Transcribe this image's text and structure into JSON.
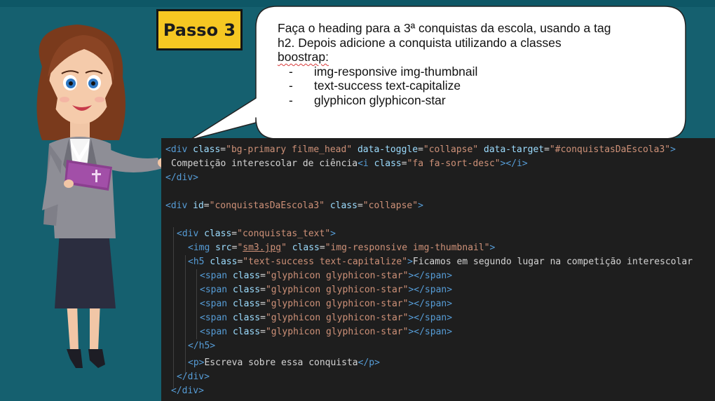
{
  "step_label": "Passo 3",
  "instructions": {
    "intro_lines": [
      "Faça o heading para a 3ª conquistas da escola, usando a tag",
      "h2. Depois adicione a conquista utilizando a classes"
    ],
    "intro_last": "boostrap:",
    "items": [
      "img-responsive img-thumbnail",
      "text-success text-capitalize",
      "glyphicon glyphicon-star"
    ],
    "bullet": "-"
  },
  "code": {
    "div_open": "<div",
    "div_close_tag": "</div>",
    "gt": ">",
    "quote": "\"",
    "eq": "=",
    "attr_class": "class",
    "attr_data_toggle": "data-toggle",
    "attr_data_target": "data-target",
    "attr_id": "id",
    "attr_src": "src",
    "val_bg_primary": "bg-primary filme_head",
    "val_collapse": "collapse",
    "val_target": "#conquistasDaEscola3",
    "text_competicao": "Competição interescolar de ciência",
    "i_open": "<i",
    "i_close": "</i>",
    "val_fa": "fa fa-sort-desc",
    "val_id": "conquistasDaEscola3",
    "val_conquistas_text": "conquistas_text",
    "img_open": "<img",
    "val_src": "sm3.jpg",
    "val_img_class": "img-responsive img-thumbnail",
    "h5_open": "<h5",
    "h5_close": "</h5>",
    "val_h5_class": "text-success text-capitalize",
    "text_ficamos": "Ficamos em segundo lugar na competição interescolar",
    "span_open": "<span",
    "span_close": "</span>",
    "val_glyph": "glyphicon glyphicon-star",
    "p_open": "<p>",
    "p_close": "</p>",
    "text_p": "Escreva sobre essa conquista"
  },
  "colors": {
    "background": "#15606f",
    "step_badge": "#f6c722",
    "code_bg": "#1e1e1e",
    "tag": "#569cd6",
    "attribute": "#9cdcfe",
    "string": "#ce9178",
    "text": "#d4d4d4"
  },
  "icons": {
    "teacher": "teacher-illustration",
    "book": "book-with-cross-icon"
  }
}
